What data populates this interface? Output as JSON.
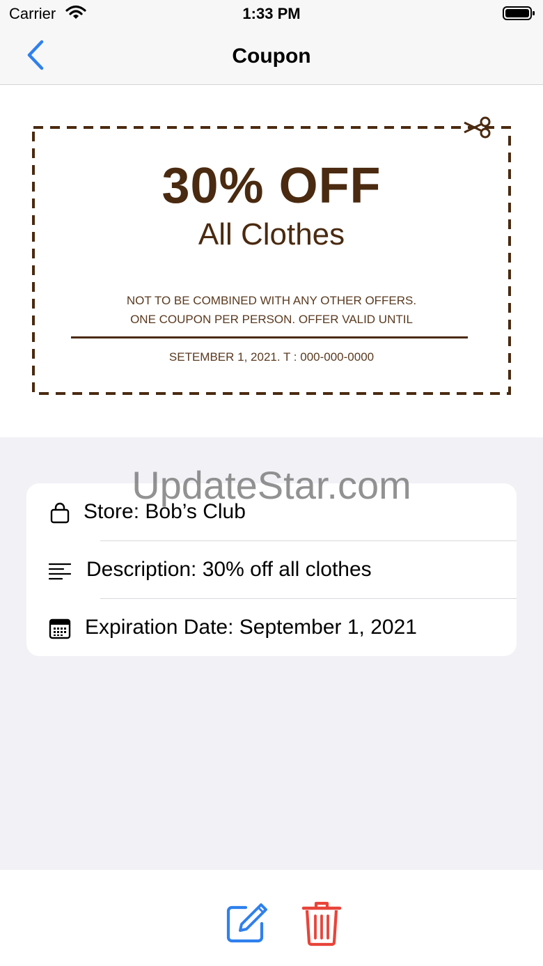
{
  "status_bar": {
    "carrier": "Carrier",
    "time": "1:33 PM"
  },
  "nav": {
    "title": "Coupon",
    "back_icon": "chevron-left-icon"
  },
  "coupon": {
    "headline": "30% OFF",
    "subheadline": "All Clothes",
    "terms_line1": "NOT TO BE COMBINED WITH ANY OTHER OFFERS.",
    "terms_line2": "ONE COUPON PER PERSON. OFFER VALID UNTIL",
    "terms_line3": "SETEMBER 1, 2021.  T : 000-000-0000",
    "color": "#4a2a10"
  },
  "watermark": "UpdateStar.com",
  "details": {
    "store": "Store: Bob’s Club",
    "description": "Description: 30% off all clothes",
    "expiration": "Expiration Date: September 1, 2021"
  },
  "toolbar": {
    "edit_icon": "edit-icon",
    "delete_icon": "trash-icon"
  },
  "colors": {
    "accent": "#2f80ed",
    "danger": "#e8443a"
  }
}
